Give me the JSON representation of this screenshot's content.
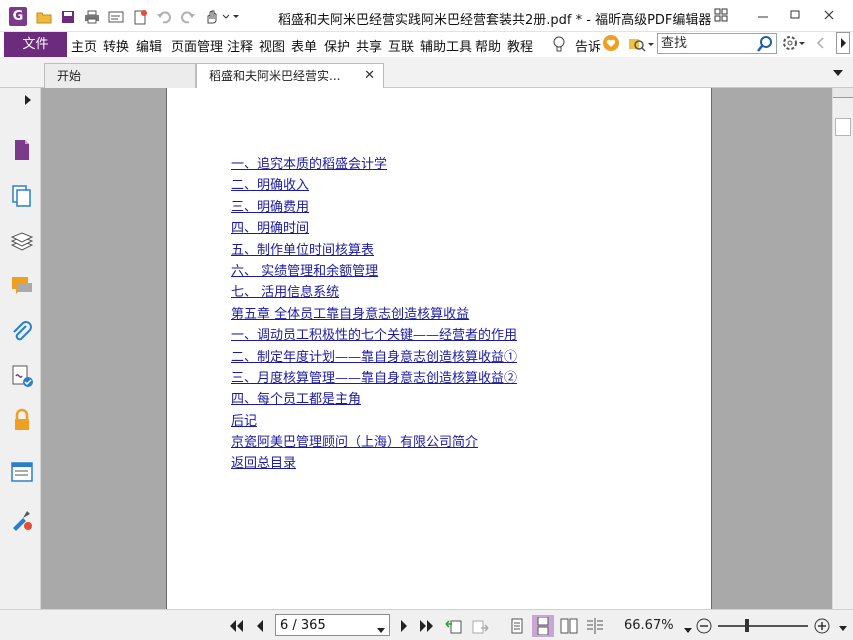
{
  "window": {
    "title": "稻盛和夫阿米巴经营实践阿米巴经营套装共2册.pdf * - 福昕高级PDF编辑器",
    "app_logo": "G"
  },
  "menu": {
    "file": "文件",
    "items": [
      "主页",
      "转换",
      "编辑",
      "页面管理",
      "注释",
      "视图",
      "表单",
      "保护",
      "共享",
      "互联",
      "辅助工具",
      "帮助",
      "教程"
    ],
    "tell_me": "告诉",
    "search_placeholder": "查找"
  },
  "tabs": [
    {
      "label": "开始",
      "active": false
    },
    {
      "label": "稻盛和夫阿米巴经营实...",
      "active": true
    }
  ],
  "toc": [
    "一、追究本质的稻盛会计学",
    "二、明确收入",
    "三、明确费用",
    "四、明确时间",
    "五、制作单位时间核算表",
    "六、 实绩管理和余额管理",
    "七、 活用信息系统",
    "第五章 全体员工靠自身意志创造核算收益",
    "一、调动员工积极性的七个关键——经营者的作用",
    "二、制定年度计划——靠自身意志创造核算收益①",
    "三、月度核算管理——靠自身意志创造核算收益②",
    "四、每个员工都是主角",
    "后记",
    "京瓷阿美巴管理顾问（上海）有限公司简介",
    "返回总目录"
  ],
  "statusbar": {
    "page_display": "6 / 365",
    "zoom": "66.67%"
  },
  "colors": {
    "accent": "#6d2b7d",
    "link": "#1a1aa6",
    "canvas": "#a9a9a9"
  }
}
